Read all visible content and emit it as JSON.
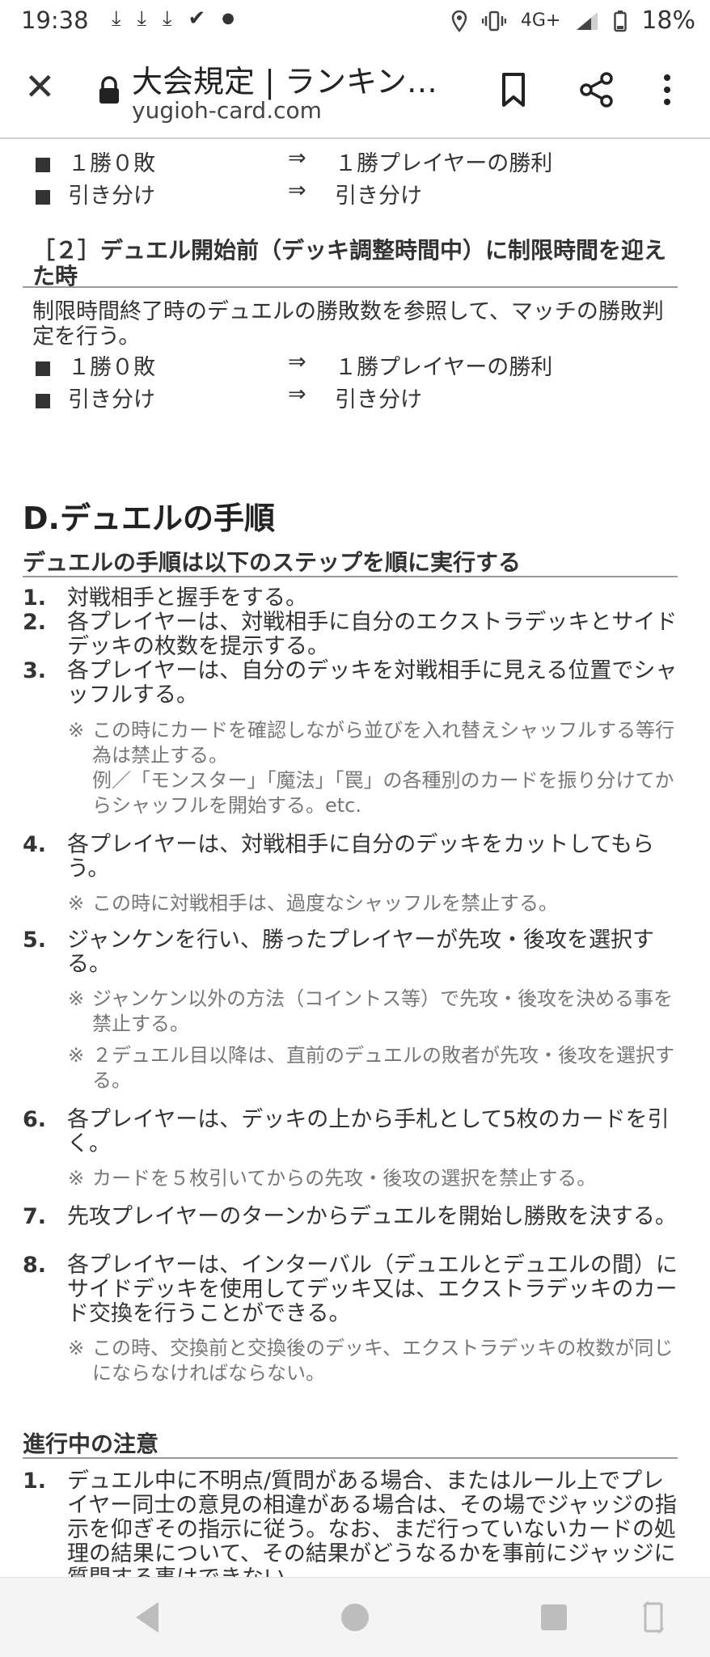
{
  "status_bar": {
    "time": "19:38",
    "left_icons": [
      "download-icon",
      "download-icon",
      "download-icon",
      "download-done-icon",
      "dot-icon"
    ],
    "network": "4G+",
    "battery": "18%"
  },
  "toolbar": {
    "title": "大会規定 | ランキン…",
    "url": "yugioh-card.com"
  },
  "section_c_top": {
    "rows": [
      {
        "left": "１勝０敗",
        "arrow": "⇒",
        "right": "１勝プレイヤーの勝利"
      },
      {
        "left": "引き分け",
        "arrow": "⇒",
        "right": "引き分け"
      }
    ]
  },
  "section_c2": {
    "heading": "［２］デュエル開始前（デッキ調整時間中）に制限時間を迎えた時",
    "text": "制限時間終了時のデュエルの勝敗数を参照して、マッチの勝敗判定を行う。",
    "rows": [
      {
        "left": "１勝０敗",
        "arrow": "⇒",
        "right": "１勝プレイヤーの勝利"
      },
      {
        "left": "引き分け",
        "arrow": "⇒",
        "right": "引き分け"
      }
    ]
  },
  "section_d": {
    "title": "D.デュエルの手順",
    "subheading": "デュエルの手順は以下のステップを順に実行する",
    "steps": [
      {
        "num": "1.",
        "text": "対戦相手と握手をする。"
      },
      {
        "num": "2.",
        "text": "各プレイヤーは、対戦相手に自分のエクストラデッキとサイドデッキの枚数を提示する。"
      },
      {
        "num": "3.",
        "text": "各プレイヤーは、自分のデッキを対戦相手に見える位置でシャッフルする。"
      },
      {
        "num": "4.",
        "text": "各プレイヤーは、対戦相手に自分のデッキをカットしてもらう。"
      },
      {
        "num": "5.",
        "text": "ジャンケンを行い、勝ったプレイヤーが先攻・後攻を選択する。"
      },
      {
        "num": "6.",
        "text": "各プレイヤーは、デッキの上から手札として5枚のカードを引く。"
      },
      {
        "num": "7.",
        "text": "先攻プレイヤーのターンからデュエルを開始し勝敗を決する。"
      },
      {
        "num": "8.",
        "text": "各プレイヤーは、インターバル（デュエルとデュエルの間）にサイドデッキを使用してデッキ又は、エクストラデッキのカード交換を行うことができる。"
      }
    ],
    "notes": {
      "mark": "※",
      "n3": "この時にカードを確認しながら並びを入れ替えシャッフルする等行為は禁止する。",
      "n3b": "例／「モンスター」「魔法」「罠」の各種別のカードを振り分けてからシャッフルを開始する。etc.",
      "n4": "この時に対戦相手は、過度なシャッフルを禁止する。",
      "n5a": "ジャンケン以外の方法（コイントス等）で先攻・後攻を決める事を禁止する。",
      "n5b": "２デュエル目以降は、直前のデュエルの敗者が先攻・後攻を選択する。",
      "n6": "カードを５枚引いてからの先攻・後攻の選択を禁止する。",
      "n8": "この時、交換前と交換後のデッキ、エクストラデッキの枚数が同じにならなければならない。"
    }
  },
  "section_progress": {
    "heading": "進行中の注意",
    "items": [
      {
        "num": "1.",
        "text": "デュエル中に不明点/質問がある場合、またはルール上でプレイヤー同士の意見の相違がある場合は、その場でジャッジの指示を仰ぎその指示に従う。なお、まだ行っていないカードの処理の結果について、その結果がどうなるかを事前にジャッジに質問する事はできない。"
      }
    ]
  },
  "nav_bar": {
    "buttons": [
      "back-icon",
      "home-icon",
      "recents-icon",
      "rotate-icon"
    ]
  }
}
